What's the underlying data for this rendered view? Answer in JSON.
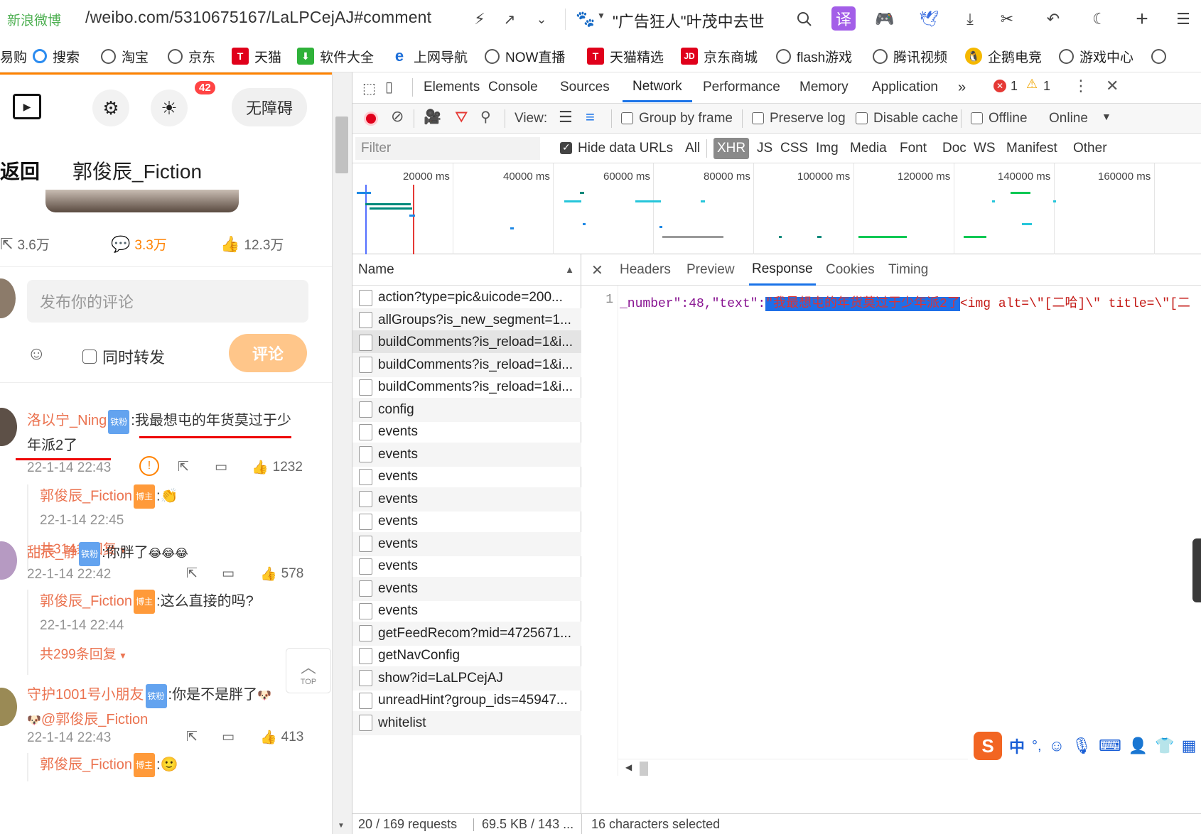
{
  "browser": {
    "site_name": "新浪微博",
    "url": "/weibo.com/5310675167/LaLPCejAJ#comment",
    "search_text": "\"广告狂人\"叶茂中去世",
    "bookmarks": [
      {
        "label": "易购",
        "icon": "globe-icon"
      },
      {
        "label": "搜索",
        "icon": "search-engine-icon"
      },
      {
        "label": "淘宝",
        "icon": "globe-icon"
      },
      {
        "label": "京东",
        "icon": "globe-icon"
      },
      {
        "label": "天猫",
        "icon": "tmall-icon"
      },
      {
        "label": "软件大全",
        "icon": "download-icon"
      },
      {
        "label": "上网导航",
        "icon": "ie-icon"
      },
      {
        "label": "NOW直播",
        "icon": "globe-icon"
      },
      {
        "label": "天猫精选",
        "icon": "tmall-icon"
      },
      {
        "label": "京东商城",
        "icon": "jd-icon"
      },
      {
        "label": "flash游戏",
        "icon": "globe-icon"
      },
      {
        "label": "腾讯视频",
        "icon": "globe-icon"
      },
      {
        "label": "企鹅电竞",
        "icon": "penguin-icon"
      },
      {
        "label": "游戏中心",
        "icon": "globe-icon"
      }
    ],
    "translate_icon_text": "译"
  },
  "page": {
    "badge_count": "42",
    "accessibility_label": "无障碍",
    "back_label": "返回",
    "author_title": "郭俊辰_Fiction",
    "stats": {
      "repost": "3.6万",
      "comment": "3.3万",
      "like": "12.3万"
    },
    "comment_placeholder": "发布你的评论",
    "also_repost_label": "同时转发",
    "comment_button": "评论",
    "top_label": "TOP",
    "comments": [
      {
        "user": "洛以宁_Ning",
        "tag": "铁粉",
        "text": ":我最想屯的年货莫过于少年派2了",
        "time": "22-1-14 22:43",
        "likes": "1232",
        "reply": {
          "user": "郭俊辰_Fiction",
          "tag": "博主",
          "text": ":",
          "time": "22-1-14 22:45"
        },
        "more": "共314条回复"
      },
      {
        "user": "甜辰_静",
        "tag": "铁粉",
        "text": ":你胖了",
        "time": "22-1-14 22:42",
        "likes": "578",
        "reply": {
          "user": "郭俊辰_Fiction",
          "tag": "博主",
          "text": ":这么直接的吗?",
          "time": "22-1-14 22:44"
        },
        "more": "共299条回复"
      },
      {
        "user": "守护1001号小朋友",
        "tag": "铁粉",
        "text": ":你是不是胖了",
        "mention": "@郭俊辰_Fiction",
        "time": "22-1-14 22:43",
        "likes": "413",
        "reply": {
          "user": "郭俊辰_Fiction",
          "tag": "博主",
          "text": ":"
        }
      }
    ]
  },
  "devtools": {
    "tabs": [
      "Elements",
      "Console",
      "Sources",
      "Network",
      "Performance",
      "Memory",
      "Application"
    ],
    "active_tab": "Network",
    "error_count": "1",
    "warning_count": "1",
    "toolbar": {
      "view_label": "View:",
      "group_by_frame": "Group by frame",
      "preserve_log": "Preserve log",
      "disable_cache": "Disable cache",
      "offline": "Offline",
      "online": "Online"
    },
    "filter": {
      "placeholder": "Filter",
      "hide_data_urls": "Hide data URLs",
      "types": [
        "All",
        "XHR",
        "JS",
        "CSS",
        "Img",
        "Media",
        "Font",
        "Doc",
        "WS",
        "Manifest",
        "Other"
      ],
      "active_type": "XHR"
    },
    "timeline_labels": [
      "20000 ms",
      "40000 ms",
      "60000 ms",
      "80000 ms",
      "100000 ms",
      "120000 ms",
      "140000 ms",
      "160000 ms"
    ],
    "name_header": "Name",
    "requests": [
      "action?type=pic&uicode=200...",
      "allGroups?is_new_segment=1...",
      "buildComments?is_reload=1&i...",
      "buildComments?is_reload=1&i...",
      "buildComments?is_reload=1&i...",
      "config",
      "events",
      "events",
      "events",
      "events",
      "events",
      "events",
      "events",
      "events",
      "events",
      "getFeedRecom?mid=4725671...",
      "getNavConfig",
      "show?id=LaLPCejAJ",
      "unreadHint?group_ids=45947...",
      "whitelist"
    ],
    "selected_request_index": 2,
    "detail_tabs": [
      "Headers",
      "Preview",
      "Response",
      "Cookies",
      "Timing"
    ],
    "active_detail_tab": "Response",
    "response": {
      "line_number": "1",
      "prefix": "_number\":48,\"text\":",
      "selected": "\"我最想屯的年货莫过于少年派2了",
      "suffix": "<img alt=\\\"[二哈]\\\" title=\\\"[二"
    },
    "status": {
      "requests": "20 / 169 requests",
      "size": "69.5 KB / 143 ...",
      "selection": "16 characters selected"
    },
    "ime": {
      "lang": "中"
    }
  }
}
